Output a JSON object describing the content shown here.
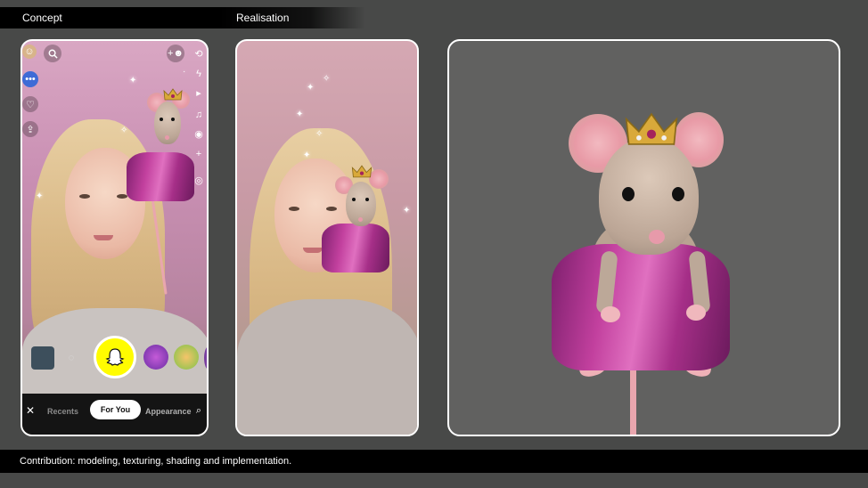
{
  "labels": {
    "concept": "Concept",
    "realisation": "Realisation"
  },
  "caption": "Contribution: modeling, texturing, shading and implementation.",
  "phone": {
    "tabs": {
      "recents": "Recents",
      "for_you": "For You",
      "appearance": "Appearance"
    },
    "close_icon": "close-icon",
    "colors": {
      "shutter": "#fffc00",
      "navbar": "#141414"
    }
  }
}
